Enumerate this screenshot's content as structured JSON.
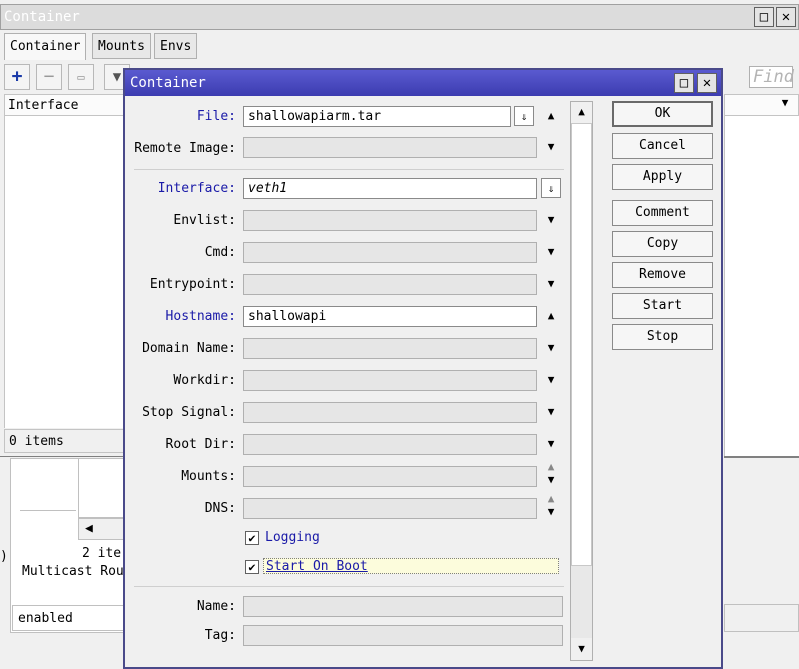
{
  "bg_window": {
    "title": "Container",
    "tabs": [
      "Container",
      "Mounts",
      "Envs"
    ],
    "find_placeholder": "Find",
    "column_header": "Interface",
    "status": "0 items",
    "lower_panel": {
      "list_count": "2 ite",
      "multicast": "Multicast Rou",
      "status": "enabled",
      "left_glyph": ")"
    }
  },
  "dialog": {
    "title": "Container",
    "fields": {
      "file": {
        "label": "File:",
        "value": "shallowapiarm.tar"
      },
      "remote_image": {
        "label": "Remote Image:",
        "value": ""
      },
      "interface": {
        "label": "Interface:",
        "value": "veth1"
      },
      "envlist": {
        "label": "Envlist:",
        "value": ""
      },
      "cmd": {
        "label": "Cmd:",
        "value": ""
      },
      "entrypoint": {
        "label": "Entrypoint:",
        "value": ""
      },
      "hostname": {
        "label": "Hostname:",
        "value": "shallowapi"
      },
      "domain_name": {
        "label": "Domain Name:",
        "value": ""
      },
      "workdir": {
        "label": "Workdir:",
        "value": ""
      },
      "stop_signal": {
        "label": "Stop Signal:",
        "value": ""
      },
      "root_dir": {
        "label": "Root Dir:",
        "value": ""
      },
      "mounts": {
        "label": "Mounts:",
        "value": ""
      },
      "dns": {
        "label": "DNS:",
        "value": ""
      },
      "name": {
        "label": "Name:",
        "value": ""
      },
      "tag": {
        "label": "Tag:",
        "value": ""
      }
    },
    "checkboxes": {
      "logging": {
        "label": "Logging",
        "checked": true
      },
      "start_on_boot": {
        "label": "Start On Boot",
        "checked": true
      }
    },
    "buttons": {
      "ok": "OK",
      "cancel": "Cancel",
      "apply": "Apply",
      "comment": "Comment",
      "copy": "Copy",
      "remove": "Remove",
      "start": "Start",
      "stop": "Stop"
    }
  },
  "colors": {
    "title_bar": "#3c3cb0",
    "label_blue": "#1a1aa8",
    "toolbar_plus": "#1a3aa8"
  }
}
